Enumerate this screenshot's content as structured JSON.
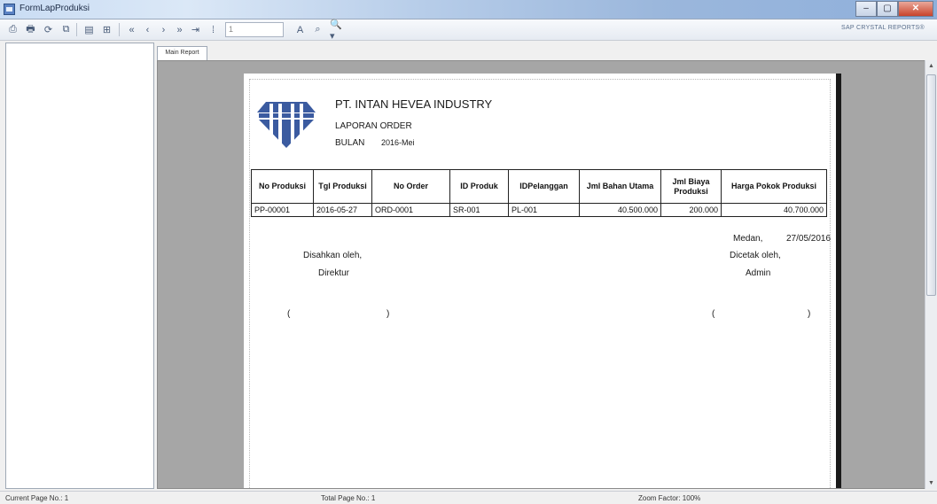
{
  "window": {
    "title": "FormLapProduksi"
  },
  "toolbar": {
    "page_input": "1",
    "brand": "SAP CRYSTAL REPORTS®",
    "icons": [
      "export-icon",
      "print-icon",
      "refresh-icon",
      "copy-icon",
      "group-tree-icon",
      "toggle-icon",
      "first-page-icon",
      "prev-page-icon",
      "next-page-icon",
      "last-page-icon",
      "goto-page-icon",
      "find-icon",
      "search-icon",
      "zoom-icon"
    ]
  },
  "tabs": [
    {
      "label": "Main Report"
    }
  ],
  "report": {
    "company": "PT. INTAN HEVEA INDUSTRY",
    "subtitle": "LAPORAN ORDER",
    "bulan_label": "BULAN",
    "bulan_value": "2016-Mei",
    "columns": [
      "No Produksi",
      "Tgl Produksi",
      "No Order",
      "ID Produk",
      "IDPelanggan",
      "Jml Bahan Utama",
      "Jml Biaya Produksi",
      "Harga Pokok Produksi"
    ],
    "rows": [
      [
        "PP-00001",
        "2016-05-27",
        "ORD-0001",
        "SR-001",
        "PL-001",
        "40.500.000",
        "200.000",
        "40.700.000"
      ]
    ],
    "footer": {
      "city": "Medan,",
      "date": "27/05/2016",
      "approved_by": "Disahkan oleh,",
      "approver_role": "Direktur",
      "printed_by": "Dicetak oleh,",
      "printer_role": "Admin",
      "sig_open": "(",
      "sig_close": ")"
    }
  },
  "statusbar": {
    "current_page": "Current Page No.: 1",
    "total_page": "Total Page No.: 1",
    "zoom": "Zoom Factor: 100%"
  },
  "colors": {
    "logo": "#3b5ba0",
    "titlebar": "#b7cde9",
    "report_bg": "#a6a6a6"
  }
}
